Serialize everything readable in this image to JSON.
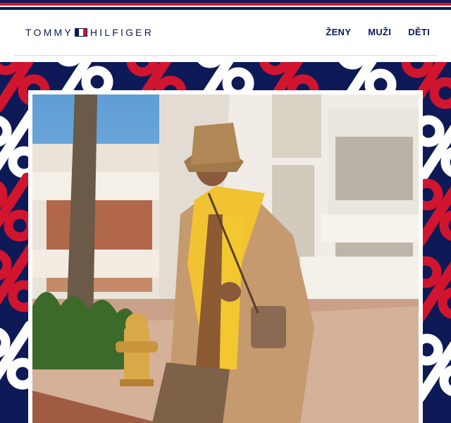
{
  "brand": {
    "name_left": "TOMMY",
    "name_right": "HILFIGER",
    "colors": {
      "navy": "#0d1a57",
      "red": "#d1152f",
      "white": "#ffffff"
    }
  },
  "nav": {
    "items": [
      {
        "label": "ŽENY"
      },
      {
        "label": "MUŽI"
      },
      {
        "label": "DĚTI"
      }
    ]
  },
  "banner": {
    "pattern_icon": "percent-sign-icon",
    "photo_description_icon": "model-in-bucket-hat-and-trench-coat"
  }
}
